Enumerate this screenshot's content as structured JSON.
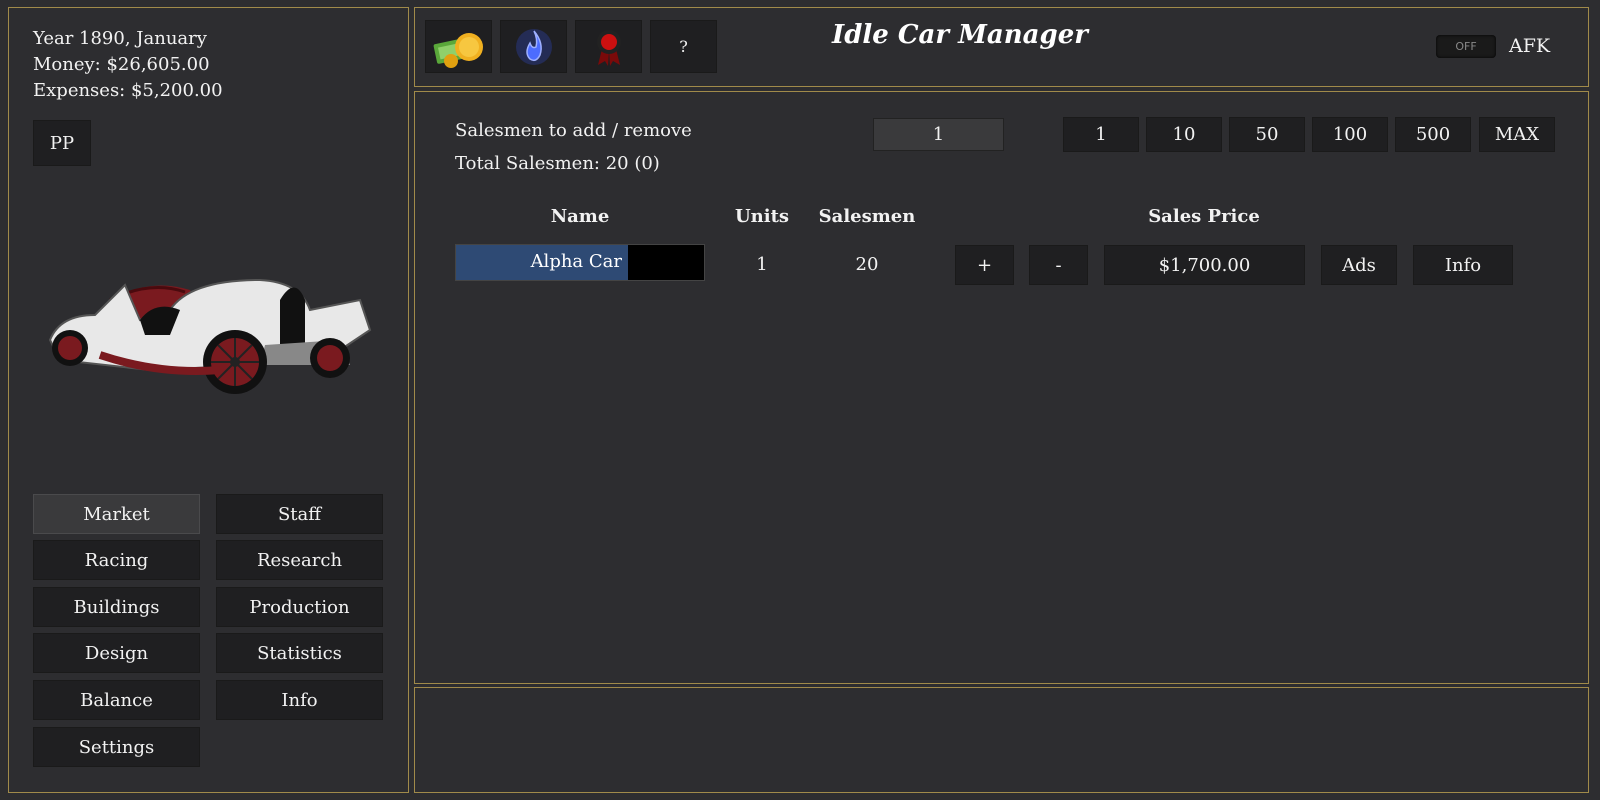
{
  "status": {
    "date": "Year 1890, January",
    "money": "Money: $26,605.00",
    "expenses": "Expenses: $5,200.00",
    "pp_label": "PP"
  },
  "nav": {
    "market": "Market",
    "staff": "Staff",
    "racing": "Racing",
    "research": "Research",
    "buildings": "Buildings",
    "production": "Production",
    "design": "Design",
    "statistics": "Statistics",
    "balance": "Balance",
    "info": "Info",
    "settings": "Settings"
  },
  "topbar": {
    "title": "Idle Car Manager",
    "help_label": "?",
    "afk_toggle": "OFF",
    "afk_label": "AFK"
  },
  "salesmen": {
    "add_remove_label": "Salesmen to add / remove",
    "amount_value": "1",
    "total_label": "Total Salesmen: 20 (0)",
    "quick_amounts": [
      "1",
      "10",
      "50",
      "100",
      "500",
      "MAX"
    ]
  },
  "table": {
    "headers": {
      "name": "Name",
      "units": "Units",
      "salesmen": "Salesmen",
      "sales_price": "Sales Price"
    },
    "rows": [
      {
        "name": "Alpha Car",
        "units": "1",
        "salesmen": "20",
        "plus": "+",
        "minus": "-",
        "price": "$1,700.00",
        "ads": "Ads",
        "info": "Info"
      }
    ]
  },
  "colors": {
    "accent_border": "#a08a4a",
    "background": "#2d2d30",
    "button": "#1f1f21",
    "name_highlight": "#2e4a74"
  },
  "icons": [
    "money-icon",
    "blue-flame-icon",
    "award-ribbon-icon",
    "help-icon"
  ]
}
